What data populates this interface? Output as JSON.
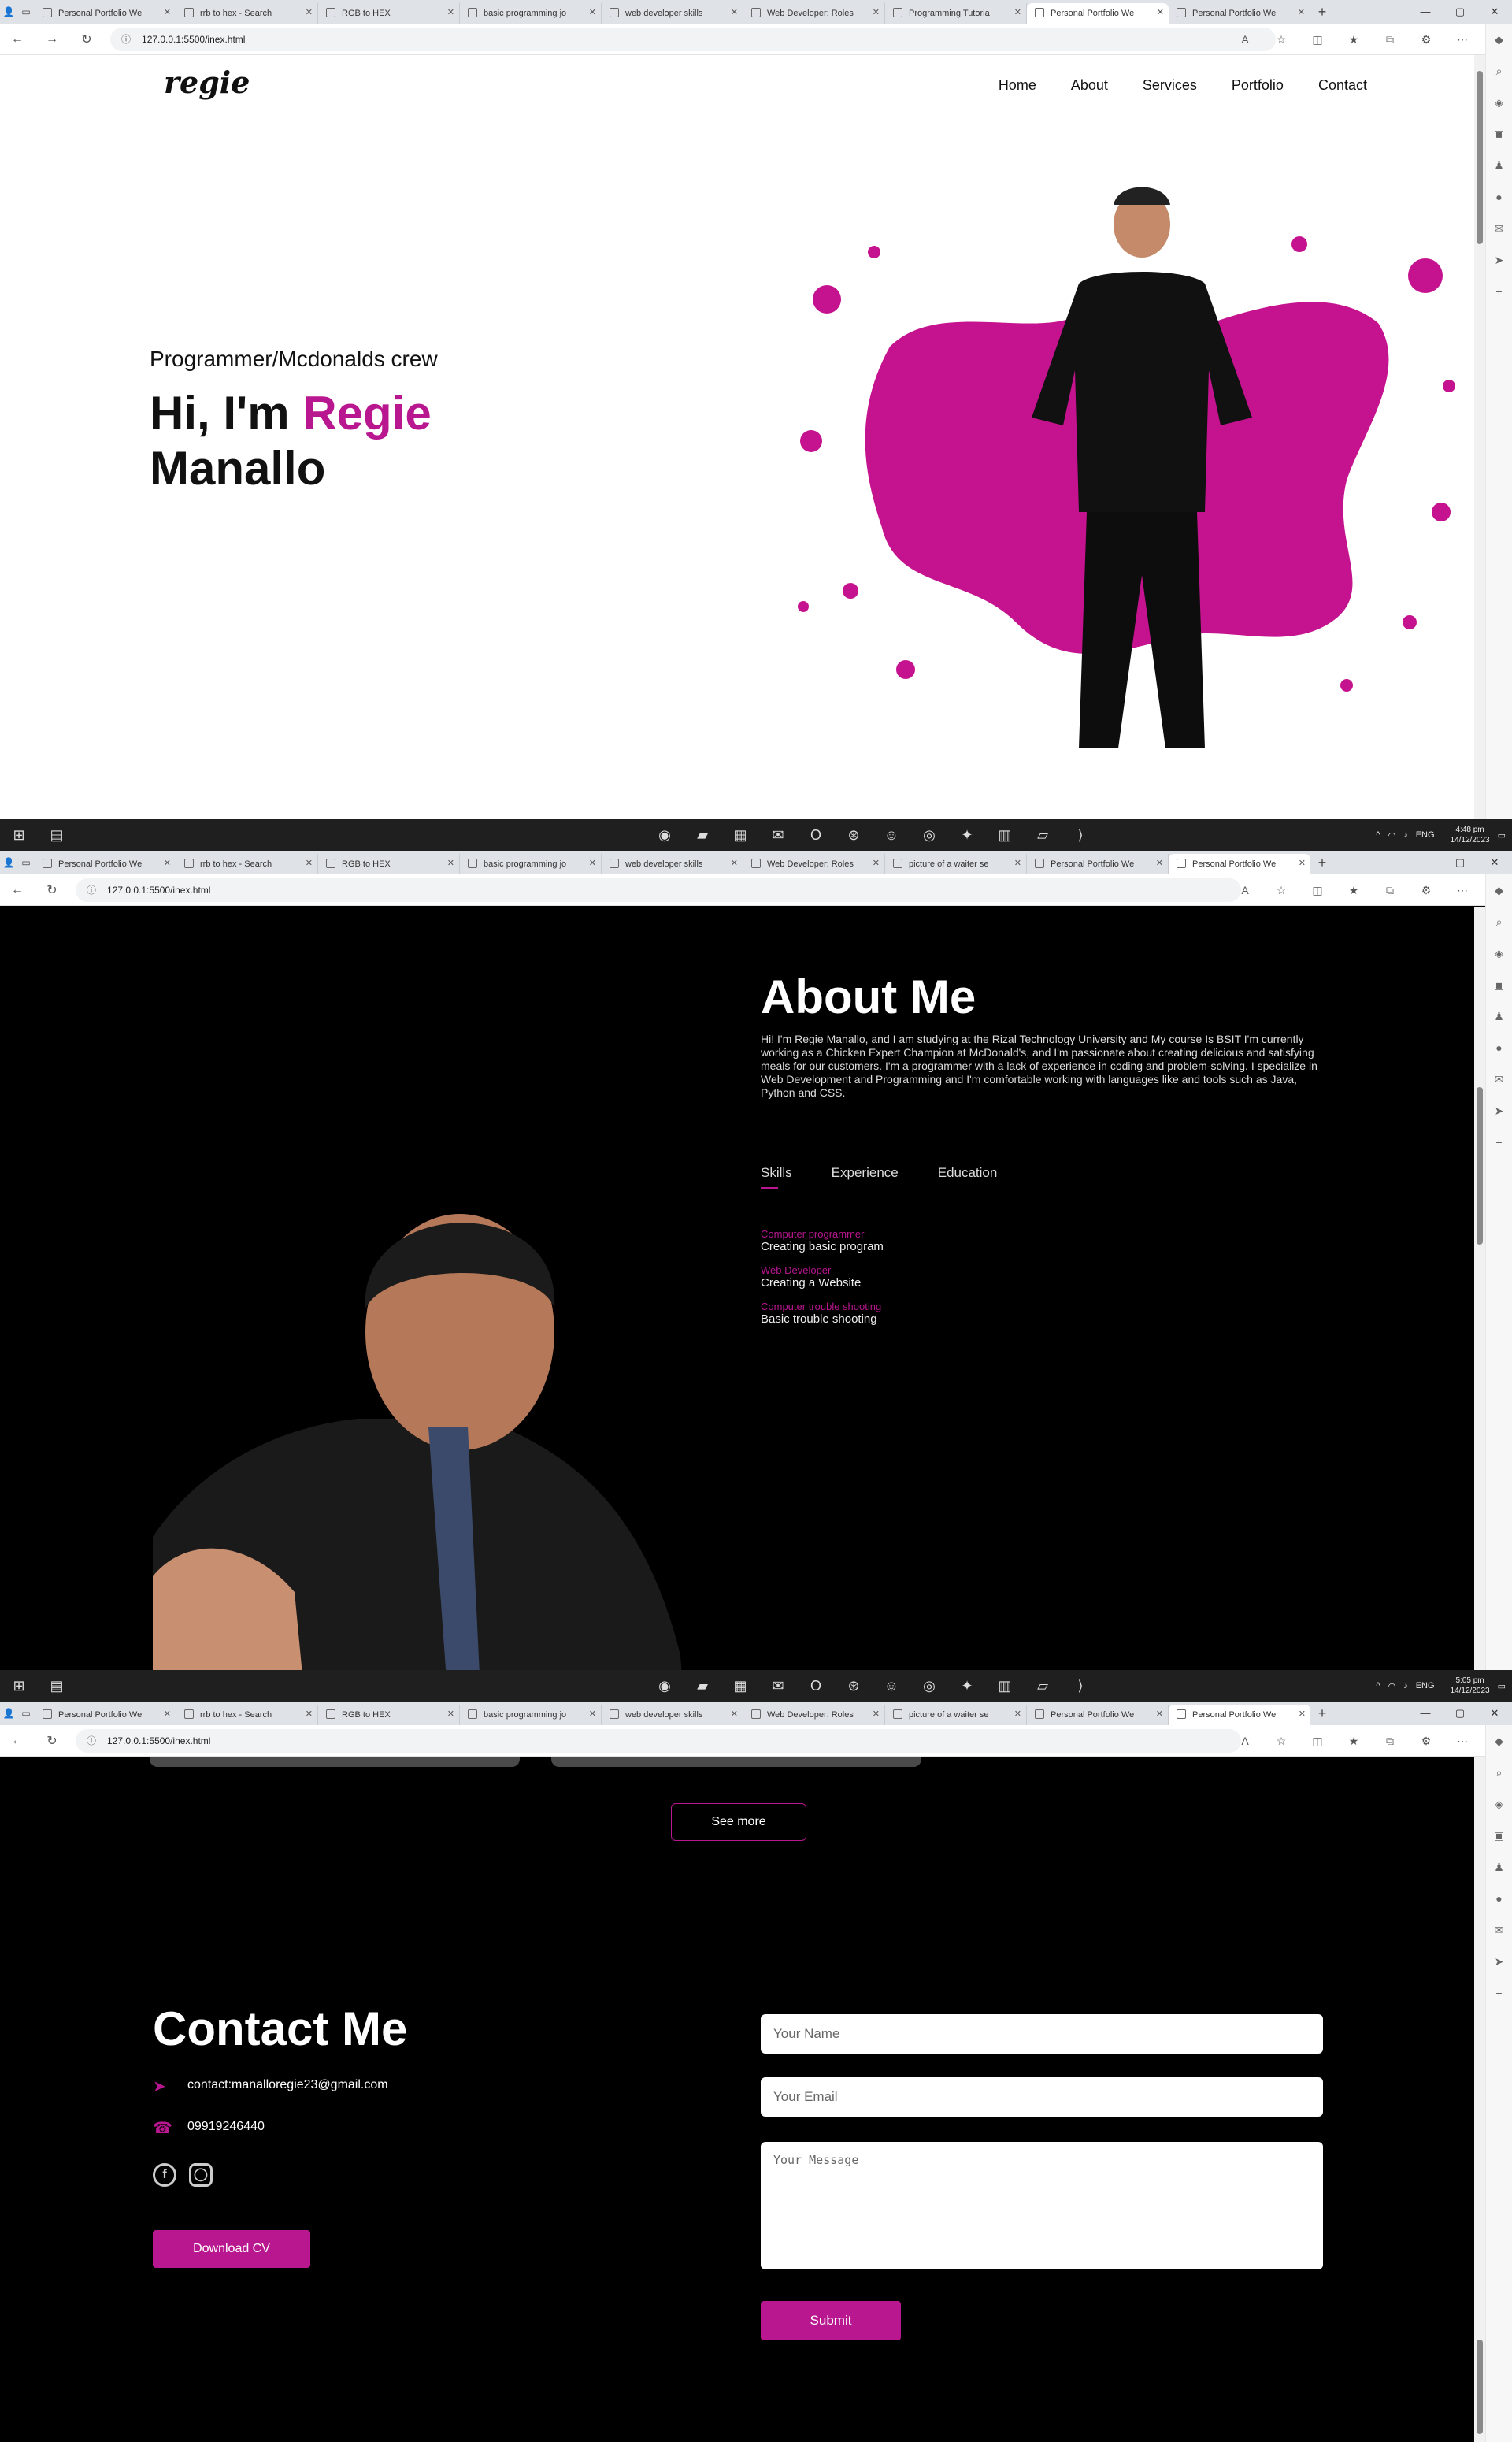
{
  "colors": {
    "accent": "#b8178f",
    "dark_bg": "#000000"
  },
  "captures": [
    {
      "tabs": [
        "Personal Portfolio We",
        "rrb to hex - Search",
        "RGB to HEX",
        "basic programming jo",
        "web developer skills",
        "Web Developer: Roles",
        "Programming Tutoria",
        "Personal Portfolio We",
        "Personal Portfolio We"
      ],
      "active_tab": 7,
      "url": "127.0.0.1:5500/inex.html"
    },
    {
      "tabs": [
        "Personal Portfolio We",
        "rrb to hex - Search",
        "RGB to HEX",
        "basic programming jo",
        "web developer skills",
        "Web Developer: Roles",
        "picture of a waiter se",
        "Personal Portfolio We",
        "Personal Portfolio We"
      ],
      "active_tab": 8,
      "url": "127.0.0.1:5500/inex.html"
    },
    {
      "tabs": [
        "Personal Portfolio We",
        "rrb to hex - Search",
        "RGB to HEX",
        "basic programming jo",
        "web developer skills",
        "Web Developer: Roles",
        "picture of a waiter se",
        "Personal Portfolio We",
        "Personal Portfolio We"
      ],
      "active_tab": 8,
      "url": "127.0.0.1:5500/inex.html"
    }
  ],
  "taskbar": [
    {
      "lang": "ENG",
      "time": "4:48 pm",
      "date": "14/12/2023"
    },
    {
      "lang": "ENG",
      "time": "5:05 pm",
      "date": "14/12/2023"
    }
  ],
  "site": {
    "logo": "regie",
    "nav": [
      "Home",
      "About",
      "Services",
      "Portfolio",
      "Contact"
    ]
  },
  "hero": {
    "subtitle": "Programmer/Mcdonalds crew",
    "greeting": "Hi, I'm",
    "name_highlight": "Regie",
    "name_rest": "Manallo"
  },
  "about": {
    "title": "About Me",
    "text": "Hi! I'm Regie Manallo, and I am studying at the Rizal Technology University and My course Is BSIT I'm currently working as a Chicken Expert Champion at McDonald's, and I'm passionate about creating delicious and satisfying meals for our customers. I'm a programmer with a lack of experience in coding and problem-solving. I specialize in Web Development and Programming and I'm comfortable working with languages like and tools such as Java, Python and CSS.",
    "tabs": [
      "Skills",
      "Experience",
      "Education"
    ],
    "active_tab": "Skills",
    "skills": [
      {
        "title": "Computer programmer",
        "desc": "Creating basic program"
      },
      {
        "title": "Web Developer",
        "desc": "Creating a Website"
      },
      {
        "title": "Computer trouble shooting",
        "desc": "Basic trouble shooting"
      }
    ]
  },
  "portfolio": {
    "see_more": "See more"
  },
  "contact": {
    "title": "Contact Me",
    "email": "contact:manalloregie23@gmail.com",
    "phone": "09919246440",
    "social": [
      "facebook-icon",
      "instagram-icon"
    ],
    "cv_button": "Download CV",
    "form": {
      "name_placeholder": "Your Name",
      "email_placeholder": "Your Email",
      "message_placeholder": "Your Message",
      "submit": "Submit"
    }
  }
}
